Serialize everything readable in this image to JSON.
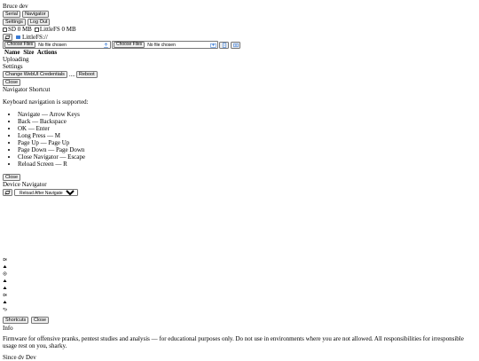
{
  "app": {
    "title": "Bruce dev"
  },
  "toolbar": {
    "serial_label": "Serial",
    "navigator_label": "Navigator",
    "settings_label": "Settings",
    "logout_label": "Log Out"
  },
  "storage": {
    "sd_label": "SD 0 MB",
    "littlefs_label": "LittleFS 0 MB"
  },
  "path": {
    "current": "LittleFS://"
  },
  "upload": {
    "file_choose_label": "Choose Files",
    "file_status": "No file chosen",
    "folder_choose_label": "Choose Files",
    "folder_status": "No file chosen"
  },
  "file_table": {
    "headers": [
      "Name",
      "Size",
      "Actions"
    ]
  },
  "uploading": {
    "title": "Uploading"
  },
  "settings": {
    "title": "Settings",
    "change_credentials_label": "Change WebUI Credentials",
    "separator": "....",
    "reboot_label": "Reboot",
    "close_label": "Close"
  },
  "navigator_shortcut": {
    "title": "Navigator Shortcut",
    "intro": "Keyboard navigation is supported:",
    "items": [
      "Navigate — Arrow Keys",
      "Back — Backspace",
      "OK — Enter",
      "Long Press — M",
      "Page Up — Page Up",
      "Page Down — Page Down",
      "Close Navigator — Escape",
      "Reload Screen — R"
    ],
    "close_label": "Close"
  },
  "device_navigator": {
    "title": "Device Navigator",
    "reload_option": "Reload After Navigate",
    "nav_icons": [
      "prev-icon",
      "up-icon",
      "ok-icon",
      "up-icon",
      "up-icon",
      "next-icon",
      "up-icon",
      "back-icon"
    ]
  },
  "footer": {
    "shortcuts_label": "Shortcuts",
    "close_label": "Close",
    "info_title": "Info",
    "info_text": "Firmware for offensive pranks, pentest studies and analysis — for educational purposes only. Do not use in environments where you are not allowed. All responsibilities for irresponsible usage rest on you, sharky.",
    "version": "Since dv Dev"
  }
}
